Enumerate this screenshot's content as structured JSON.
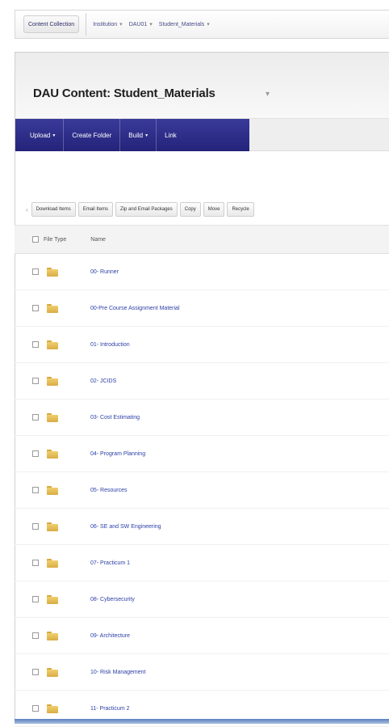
{
  "topbar": {
    "course_button": "Content Collection",
    "crumbs": [
      {
        "label": "Institution"
      },
      {
        "label": "DAU01"
      },
      {
        "label": "Student_Materials"
      }
    ]
  },
  "page": {
    "title": "DAU Content: Student_Materials"
  },
  "actions": [
    {
      "label": "Upload",
      "has_menu": true
    },
    {
      "label": "Create Folder",
      "has_menu": false
    },
    {
      "label": "Build",
      "has_menu": true
    },
    {
      "label": "Link",
      "has_menu": false
    }
  ],
  "file_actions": [
    "Download Items",
    "Email Items",
    "Zip and Email Packages",
    "Copy",
    "Move",
    "Recycle"
  ],
  "table": {
    "headers": {
      "type": "File Type",
      "name": "Name"
    },
    "rows": [
      {
        "name": "00- Runner"
      },
      {
        "name": "00-Pre Course Assignment Material"
      },
      {
        "name": "01- Introduction"
      },
      {
        "name": "02- JCIDS"
      },
      {
        "name": "03- Cost Estimating"
      },
      {
        "name": "04- Program Planning"
      },
      {
        "name": "05- Resources"
      },
      {
        "name": "06- SE and SW Engineering"
      },
      {
        "name": "07- Practicum 1"
      },
      {
        "name": "08- Cybersecurity"
      },
      {
        "name": "09- Architecture"
      },
      {
        "name": "10- Risk Management"
      },
      {
        "name": "11- Practicum 2"
      }
    ]
  },
  "colors": {
    "action_bar": "#2b2b85",
    "folder": "#e2b84f",
    "link": "#2b3fa6"
  }
}
